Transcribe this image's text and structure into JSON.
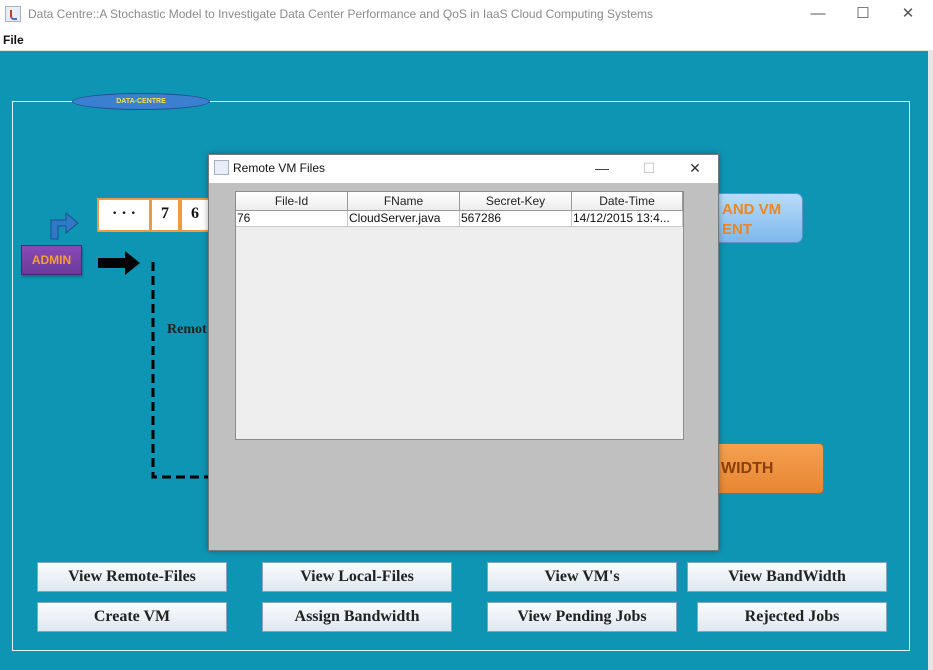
{
  "window": {
    "title": "Data Centre::A Stochastic Model to Investigate Data Center Performance and QoS in IaaS Cloud Computing Systems",
    "minimize": "—",
    "maximize": "☐",
    "close": "✕"
  },
  "menu": {
    "file": "File"
  },
  "background": {
    "frame_title": "DATA-CENTRE",
    "pipeline_boxes": [
      "· · ·",
      "7",
      "6"
    ],
    "admin": "ADMIN",
    "remote_label": "Remot",
    "mgmt_button": "AND VM\nENT",
    "bandwidth_button": "WIDTH"
  },
  "buttons": {
    "row1": [
      "View Remote-Files",
      "View Local-Files",
      "View VM's",
      "View BandWidth"
    ],
    "row2": [
      "Create VM",
      "Assign Bandwidth",
      "View Pending Jobs",
      "Rejected Jobs"
    ]
  },
  "dialog": {
    "title": "Remote VM Files",
    "minimize": "—",
    "maximize": "☐",
    "close": "✕",
    "columns": [
      "File-Id",
      "FName",
      "Secret-Key",
      "Date-Time"
    ],
    "rows": [
      [
        "76",
        "CloudServer.java",
        "567286",
        "14/12/2015   13:4..."
      ]
    ]
  },
  "colors": {
    "background": "#0f95b4",
    "admin": "#6a3a9c",
    "accent_orange": "#e78632"
  }
}
